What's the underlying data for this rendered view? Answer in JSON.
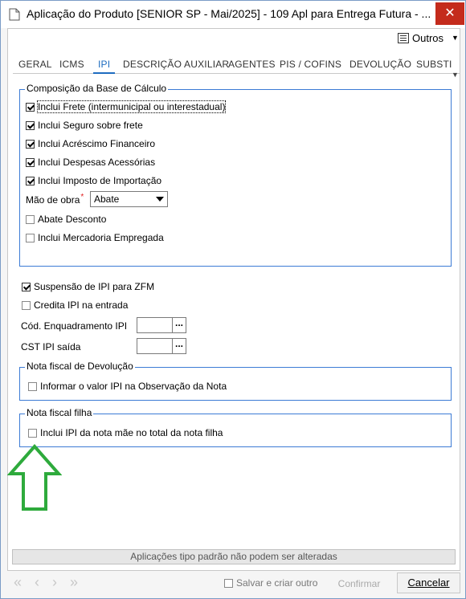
{
  "window": {
    "title": "Aplicação do Produto [SENIOR SP - Mai/2025]  - 109 Apl para Entrega Futura - ...",
    "close_glyph": "✕"
  },
  "toolbar": {
    "outros_label": "Outros"
  },
  "tabs": [
    {
      "label": "GERAL",
      "active": false
    },
    {
      "label": "ICMS",
      "active": false
    },
    {
      "label": "IPI",
      "active": true
    },
    {
      "label": "DESCRIÇÃO AUXILIAR",
      "active": false
    },
    {
      "label": "AGENTES",
      "active": false
    },
    {
      "label": "PIS / COFINS",
      "active": false
    },
    {
      "label": "DEVOLUÇÃO",
      "active": false
    },
    {
      "label": "SUBSTI",
      "active": false
    }
  ],
  "composicao": {
    "title": "Composição da Base de Cálculo",
    "items": [
      {
        "label": "Inclui Frete (intermunicipal ou interestadual)",
        "checked": true
      },
      {
        "label": "Inclui Seguro sobre frete",
        "checked": true
      },
      {
        "label": "Inclui Acréscimo Financeiro",
        "checked": true
      },
      {
        "label": "Inclui Despesas Acessórias",
        "checked": true
      },
      {
        "label": "Inclui Imposto de Importação",
        "checked": true
      }
    ],
    "mao_de_obra": {
      "label": "Mão de obra",
      "required_mark": "*",
      "value": "Abate"
    },
    "items2": [
      {
        "label": "Abate Desconto",
        "checked": false
      },
      {
        "label": "Inclui Mercadoria Empregada",
        "checked": false
      }
    ]
  },
  "ipi": {
    "suspensao": {
      "label": "Suspensão de IPI para ZFM",
      "checked": true
    },
    "credita": {
      "label": "Credita IPI na entrada",
      "checked": false
    },
    "enquadramento_label": "Cód. Enquadramento IPI",
    "cst_label": "CST IPI saída",
    "lookup_glyph": "..."
  },
  "devolucao": {
    "title": "Nota fiscal de Devolução",
    "item": {
      "label": "Informar o valor IPI na Observação da Nota",
      "checked": false
    }
  },
  "filha": {
    "title": "Nota fiscal filha",
    "item": {
      "label": "Inclui IPI da nota mãe no total da nota filha",
      "checked": false
    }
  },
  "notice": "Aplicações tipo padrão não podem ser alteradas",
  "footer": {
    "save_create_label": "Salvar e criar outro",
    "confirm_label": "Confirmar",
    "cancel_label": "Cancelar"
  },
  "colors": {
    "accent": "#1e6cc0",
    "group_border": "#3c7bd5",
    "close": "#c42b1c",
    "annotation_arrow": "#2eaa3c"
  }
}
